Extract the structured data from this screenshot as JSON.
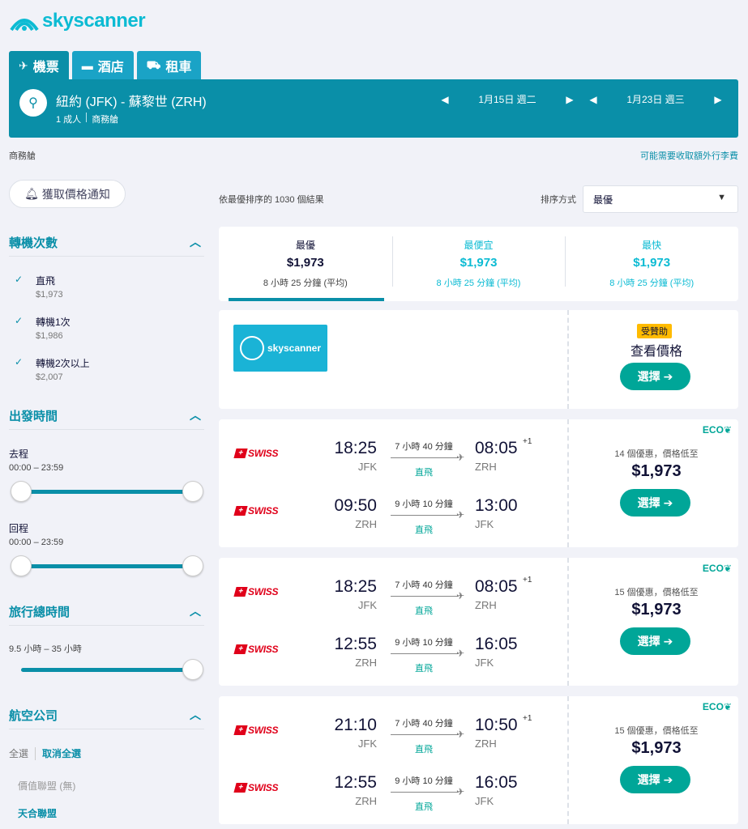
{
  "brand": {
    "name": "skyscanner",
    "color": "#0cbbd3",
    "accent": "#0a8fa8",
    "cta": "#00a698"
  },
  "tabs": [
    {
      "icon": "plane-icon",
      "label": "機票"
    },
    {
      "icon": "bed-icon",
      "label": "酒店"
    },
    {
      "icon": "car-icon",
      "label": "租車"
    }
  ],
  "search": {
    "route": "紐約 (JFK) - 蘇黎世 (ZRH)",
    "passengers": "1 成人",
    "cabin": "商務艙",
    "depart_date": "1月15日 週二",
    "return_date": "1月23日 週三"
  },
  "cabin_label": "商務艙",
  "baggage_link": "可能需要收取額外行李費",
  "price_alert": "獲取價格通知",
  "filters": {
    "stops": {
      "title": "轉機次數",
      "items": [
        {
          "label": "直飛",
          "price": "$1,973"
        },
        {
          "label": "轉機1次",
          "price": "$1,986"
        },
        {
          "label": "轉機2次以上",
          "price": "$2,007"
        }
      ]
    },
    "times": {
      "title": "出發時間",
      "outbound_label": "去程",
      "outbound_range": "00:00 – 23:59",
      "return_label": "回程",
      "return_range": "00:00 – 23:59"
    },
    "duration": {
      "title": "旅行總時間",
      "range": "9.5 小時 – 35 小時"
    },
    "airlines": {
      "title": "航空公司",
      "select_all": "全選",
      "clear_all": "取消全選",
      "alliances": [
        "價值聯盟 (無)",
        "天合聯盟"
      ]
    }
  },
  "results": {
    "count_text": "依最優排序的 1030 個結果",
    "sort_label": "排序方式",
    "sort_value": "最優"
  },
  "sort_tabs": [
    {
      "title": "最優",
      "price": "$1,973",
      "duration": "8 小時 25 分鐘 (平均)"
    },
    {
      "title": "最便宜",
      "price": "$1,973",
      "duration": "8 小時 25 分鐘 (平均)"
    },
    {
      "title": "最快",
      "price": "$1,973",
      "duration": "8 小時 25 分鐘 (平均)"
    }
  ],
  "ad": {
    "badge": "受贊助",
    "title": "查看價格",
    "button": "選擇",
    "logo_text": "skyscanner"
  },
  "itineraries": [
    {
      "eco": "ECO",
      "deals": "14 個優惠，價格低至",
      "price": "$1,973",
      "button": "選擇",
      "legs": [
        {
          "airline": "SWISS",
          "dep_time": "18:25",
          "dep_airport": "JFK",
          "duration": "7 小時 40 分鐘",
          "stops": "直飛",
          "arr_time": "08:05",
          "arr_airport": "ZRH",
          "plus": "+1"
        },
        {
          "airline": "SWISS",
          "dep_time": "09:50",
          "dep_airport": "ZRH",
          "duration": "9 小時 10 分鐘",
          "stops": "直飛",
          "arr_time": "13:00",
          "arr_airport": "JFK",
          "plus": ""
        }
      ]
    },
    {
      "eco": "ECO",
      "deals": "15 個優惠，價格低至",
      "price": "$1,973",
      "button": "選擇",
      "legs": [
        {
          "airline": "SWISS",
          "dep_time": "18:25",
          "dep_airport": "JFK",
          "duration": "7 小時 40 分鐘",
          "stops": "直飛",
          "arr_time": "08:05",
          "arr_airport": "ZRH",
          "plus": "+1"
        },
        {
          "airline": "SWISS",
          "dep_time": "12:55",
          "dep_airport": "ZRH",
          "duration": "9 小時 10 分鐘",
          "stops": "直飛",
          "arr_time": "16:05",
          "arr_airport": "JFK",
          "plus": ""
        }
      ]
    },
    {
      "eco": "ECO",
      "deals": "15 個優惠，價格低至",
      "price": "$1,973",
      "button": "選擇",
      "legs": [
        {
          "airline": "SWISS",
          "dep_time": "21:10",
          "dep_airport": "JFK",
          "duration": "7 小時 40 分鐘",
          "stops": "直飛",
          "arr_time": "10:50",
          "arr_airport": "ZRH",
          "plus": "+1"
        },
        {
          "airline": "SWISS",
          "dep_time": "12:55",
          "dep_airport": "ZRH",
          "duration": "9 小時 10 分鐘",
          "stops": "直飛",
          "arr_time": "16:05",
          "arr_airport": "JFK",
          "plus": ""
        }
      ]
    }
  ]
}
